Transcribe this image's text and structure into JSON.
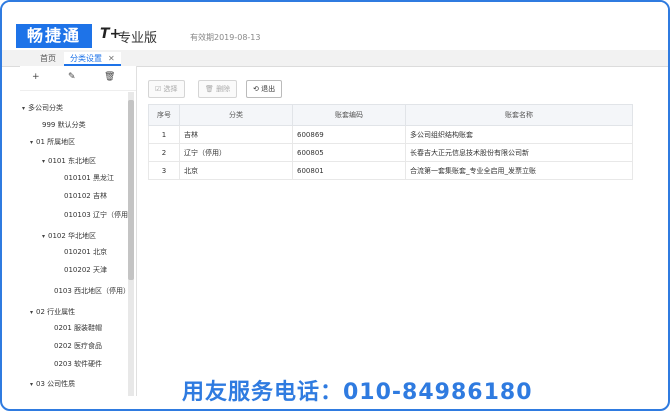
{
  "app": {
    "logo": "畅捷通",
    "product": "T+",
    "edition": "专业版",
    "valid_until": "有效期2019-08-13"
  },
  "tabs": [
    {
      "label": "首页"
    },
    {
      "label": "分类设置",
      "close": "✕"
    }
  ],
  "left_toolbar": {
    "add": "+",
    "edit": "✎",
    "delete": "🗑"
  },
  "tree": [
    {
      "label": "多公司分类",
      "toggle": "▾"
    },
    {
      "label": "999 默认分类"
    },
    {
      "label": "01 所属地区",
      "toggle": "▾",
      "selected": true
    },
    {
      "label": "0101 东北地区",
      "toggle": "▾"
    },
    {
      "label": "010101 黑龙江"
    },
    {
      "label": "010102 吉林"
    },
    {
      "label": "010103 辽宁（停用"
    },
    {
      "label": "0102 华北地区",
      "toggle": "▾"
    },
    {
      "label": "010201 北京"
    },
    {
      "label": "010202 天津"
    },
    {
      "label": "0103 西北地区（停用）"
    },
    {
      "label": "02 行业属性",
      "toggle": "▾"
    },
    {
      "label": "0201 服装鞋帽"
    },
    {
      "label": "0202 医疗食品"
    },
    {
      "label": "0203 软件硬件"
    },
    {
      "label": "03 公司性质",
      "toggle": "▾"
    }
  ],
  "toolbar": {
    "select": "选择",
    "delete": "删除",
    "exit": "退出"
  },
  "grid": {
    "headers": [
      "序号",
      "分类",
      "账套编码",
      "账套名称"
    ],
    "rows": [
      [
        "1",
        "吉林",
        "600869",
        "多公司组织结构账套"
      ],
      [
        "2",
        "辽宁（停用）",
        "600805",
        "长春吉大正元信息技术股份有限公司新"
      ],
      [
        "3",
        "北京",
        "600801",
        "合流第一套集账套_专业全启用_发票立账"
      ]
    ]
  },
  "hotline": "用友服务电话：010-84986180",
  "colors": {
    "brand": "#1e73e8",
    "frame": "#2f7be0"
  }
}
